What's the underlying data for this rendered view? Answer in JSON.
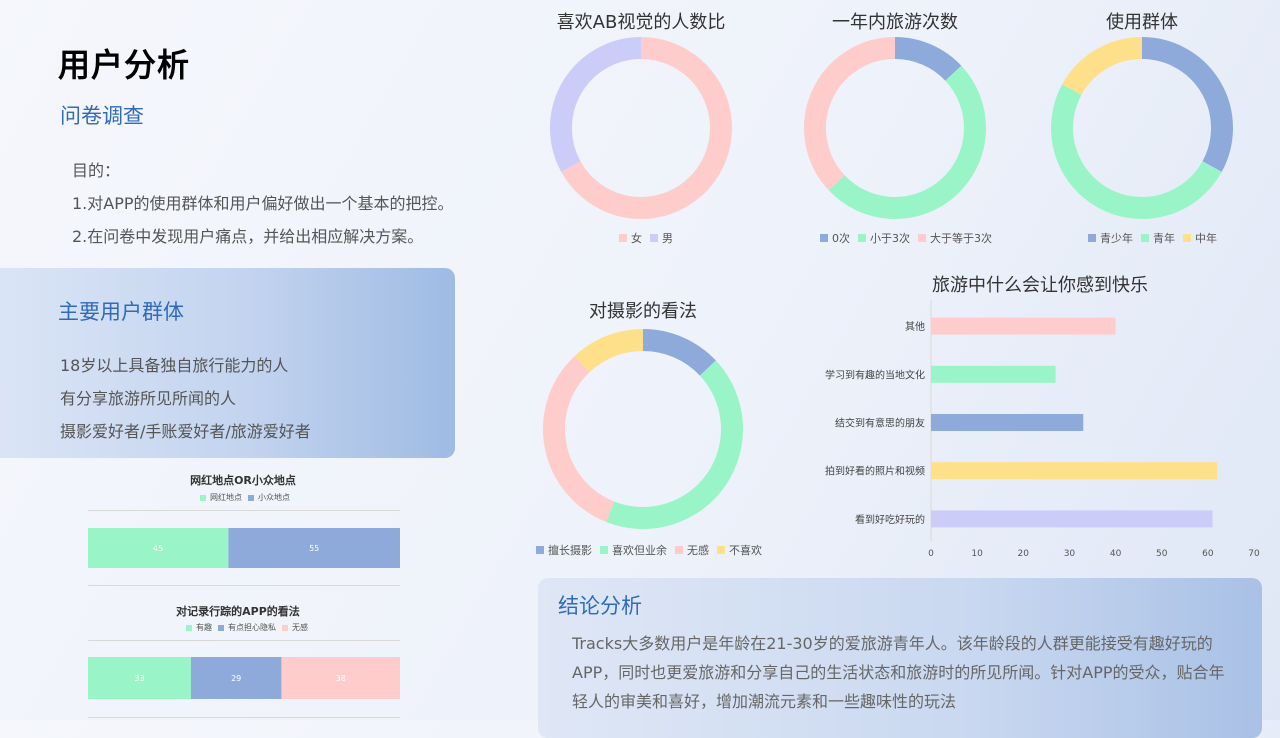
{
  "page": {
    "title": "用户分析",
    "survey_heading": "问卷调查",
    "goals": [
      "目的：",
      "1.对APP的使用群体和用户偏好做出一个基本的把控。",
      "2.在问卷中发现用户痛点，并给出相应解决方案。"
    ],
    "main_users_heading": "主要用户群体",
    "main_users": [
      "18岁以上具备独自旅行能力的人",
      "有分享旅游所见所闻的人",
      "摄影爱好者/手账爱好者/旅游爱好者"
    ],
    "conclusion_heading": "结论分析",
    "conclusion_lines": [
      "Tracks大多数用户是年龄在21-30岁的爱旅游青年人。该年龄段的人群更能接受有趣好玩的",
      "APP，同时也更爱旅游和分享自己的生活状态和旅游时的所见所闻。针对APP的受众，贴合年",
      "轻人的审美和喜好，增加潮流元素和一些趣味性的玩法"
    ]
  },
  "colors": {
    "blue": "#8eaadb",
    "green": "#99f5c8",
    "pink": "#ffcccc",
    "yellow": "#ffe08a",
    "lavender": "#ccccf8",
    "heading_blue": "#2f6bb8"
  },
  "chart_data": [
    {
      "id": "gender",
      "type": "pie",
      "title": "喜欢AB视觉的人数比",
      "labels": [
        "女",
        "男"
      ],
      "values": [
        67,
        33
      ],
      "colors": [
        "#ffcccc",
        "#ccccf8"
      ]
    },
    {
      "id": "trips",
      "type": "pie",
      "title": "一年内旅游次数",
      "labels": [
        "0次",
        "小于3次",
        "大于等于3次"
      ],
      "values": [
        13,
        50,
        37
      ],
      "colors": [
        "#8eaadb",
        "#99f5c8",
        "#ffcccc"
      ]
    },
    {
      "id": "groups",
      "type": "pie",
      "title": "使用群体",
      "labels": [
        "青少年",
        "青年",
        "中年"
      ],
      "values": [
        33,
        50,
        17
      ],
      "colors": [
        "#8eaadb",
        "#99f5c8",
        "#ffe08a"
      ]
    },
    {
      "id": "photo",
      "type": "pie",
      "title": "对摄影的看法",
      "labels": [
        "擅长摄影",
        "喜欢但业余",
        "无感",
        "不喜欢"
      ],
      "values": [
        13,
        43,
        32,
        12
      ],
      "colors": [
        "#8eaadb",
        "#99f5c8",
        "#ffcccc",
        "#ffe08a"
      ]
    },
    {
      "id": "happy",
      "type": "bar",
      "orientation": "horizontal",
      "title": "旅游中什么会让你感到快乐",
      "categories": [
        "其他",
        "学习到有趣的当地文化",
        "结交到有意思的朋友",
        "拍到好看的照片和视频",
        "看到好吃好玩的"
      ],
      "values": [
        40,
        27,
        33,
        62,
        61
      ],
      "colors": [
        "#ffcccc",
        "#99f5c8",
        "#8eaadb",
        "#ffe08a",
        "#ccccf8"
      ],
      "xlim": [
        0,
        70
      ],
      "xticks": [
        "0",
        "10",
        "20",
        "30",
        "40",
        "50",
        "60",
        "70"
      ]
    },
    {
      "id": "spots",
      "type": "bar",
      "stacked": true,
      "title": "网红地点OR小众地点",
      "series": [
        {
          "name": "网红地点",
          "values": [
            45
          ],
          "color": "#99f5c8"
        },
        {
          "name": "小众地点",
          "values": [
            55
          ],
          "color": "#8eaadb"
        }
      ]
    },
    {
      "id": "tracking",
      "type": "bar",
      "stacked": true,
      "title": "对记录行踪的APP的看法",
      "series": [
        {
          "name": "有趣",
          "values": [
            33
          ],
          "color": "#99f5c8"
        },
        {
          "name": "有点担心隐私",
          "values": [
            29
          ],
          "color": "#8eaadb"
        },
        {
          "name": "无感",
          "values": [
            38
          ],
          "color": "#ffcccc"
        }
      ]
    }
  ]
}
